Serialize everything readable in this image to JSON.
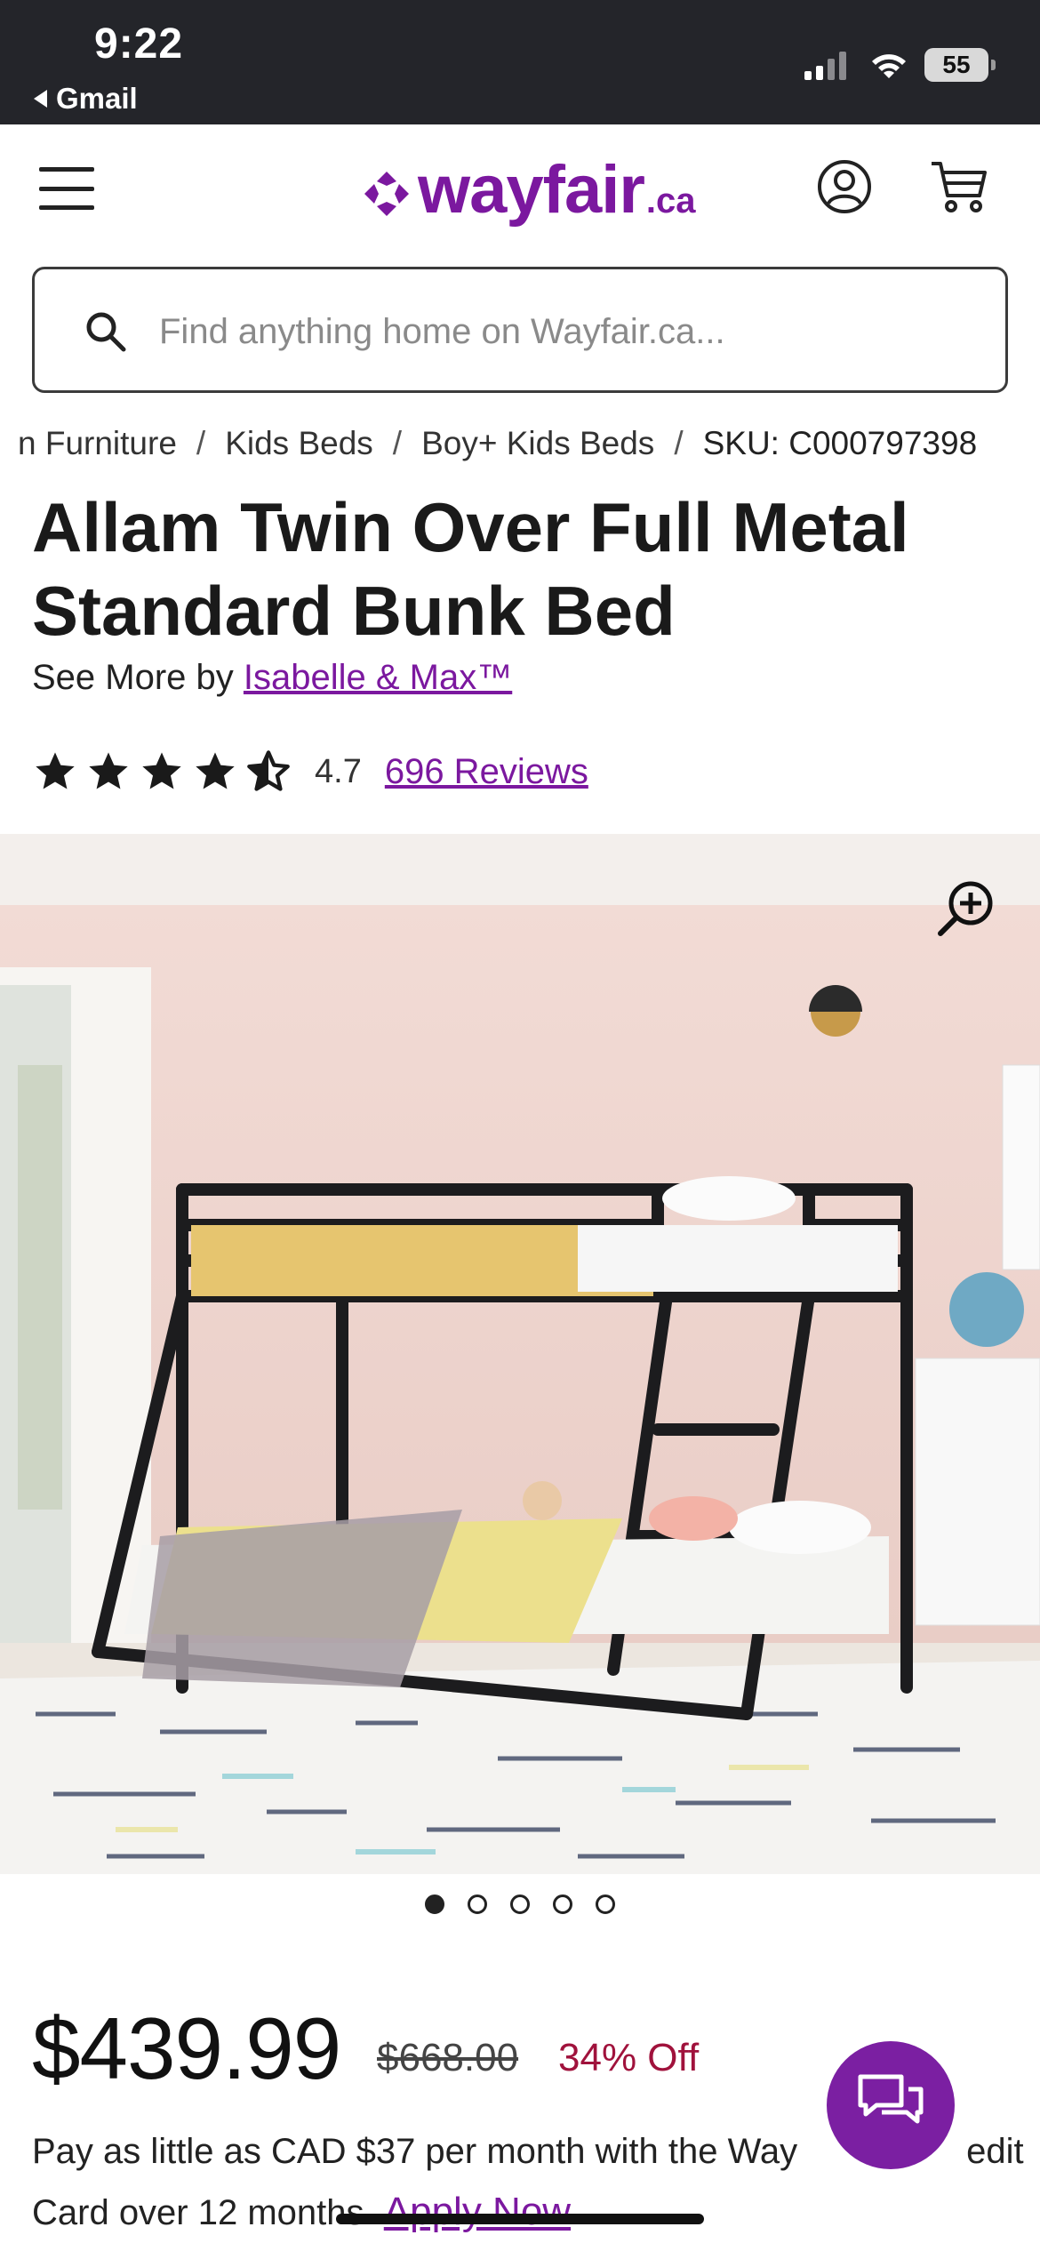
{
  "status_bar": {
    "time": "9:22",
    "back_app": "Gmail",
    "battery": "55"
  },
  "header": {
    "logo_text": "wayfair",
    "logo_suffix": ".ca",
    "brand_color": "#7b189f"
  },
  "search": {
    "placeholder": "Find anything home on Wayfair.ca..."
  },
  "breadcrumb": [
    "n Furniture",
    "Kids Beds",
    "Boy+ Kids Beds",
    "SKU: C000797398"
  ],
  "product": {
    "title": "Allam Twin Over Full Metal Standard Bunk Bed",
    "see_more_prefix": "See More by",
    "brand": "Isabelle & Max™",
    "rating_value": "4.7",
    "rating_stars": 4.7,
    "reviews": "696 Reviews"
  },
  "gallery": {
    "image_count": 5,
    "active_index": 0
  },
  "pricing": {
    "price": "$439.99",
    "old_price": "$668.00",
    "discount": "34% Off",
    "finance_line1": "Pay as little as CAD $37 per month with the Way",
    "finance_line1_end": "edit",
    "finance_line2": "Card over 12 months.",
    "apply_label": "Apply Now"
  },
  "colors": {
    "accent": "#7b189f",
    "discount": "#a0123c",
    "chat": "#7b1fa2"
  }
}
